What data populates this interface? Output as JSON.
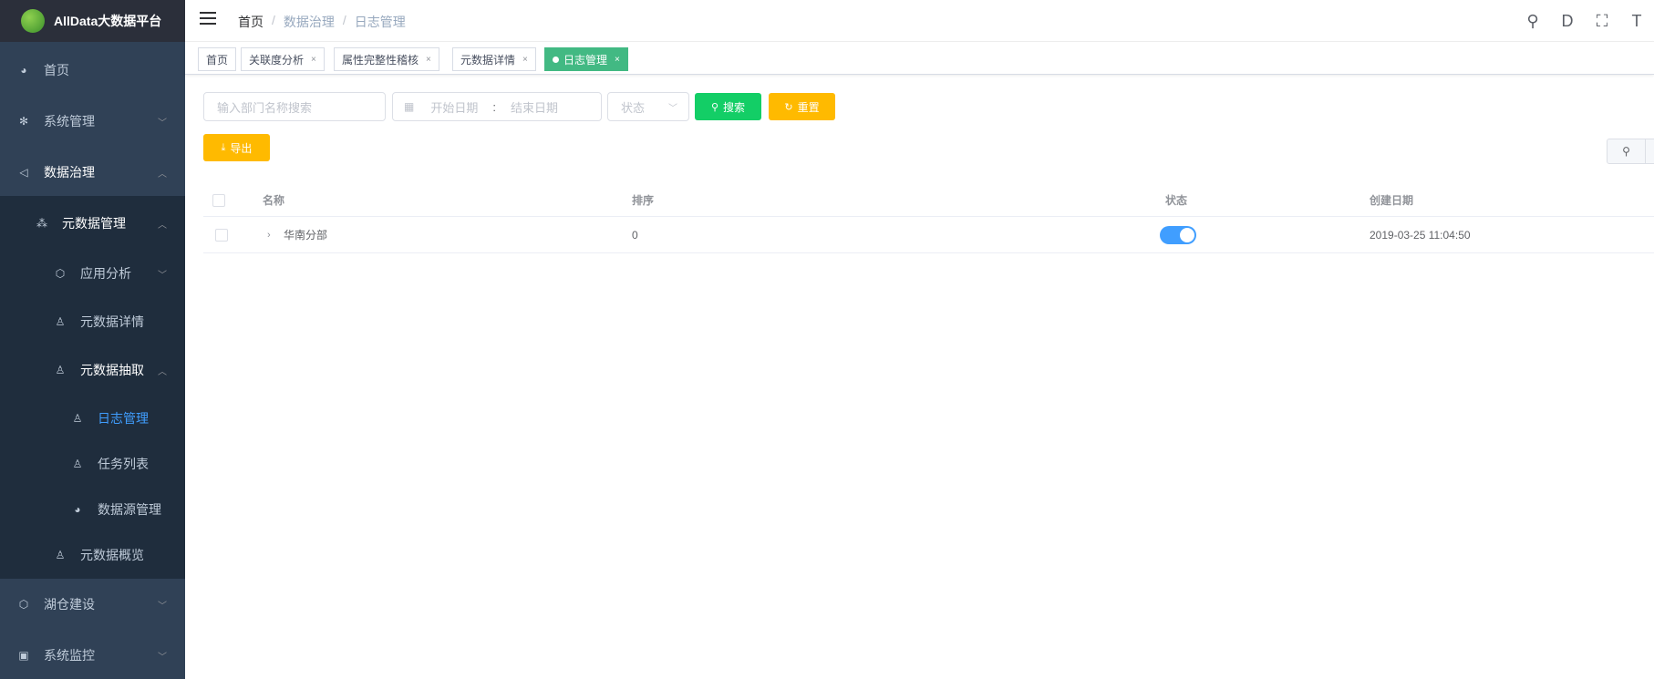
{
  "app": {
    "title": "AllData大数据平台"
  },
  "sidebar": {
    "items": [
      {
        "label": "首页",
        "icon": "dashboard-icon"
      },
      {
        "label": "系统管理",
        "icon": "gear-icon"
      },
      {
        "label": "数据治理",
        "icon": "send-icon"
      },
      {
        "label": "元数据管理",
        "icon": "tree-icon"
      },
      {
        "label": "应用分析",
        "icon": "cube-icon"
      },
      {
        "label": "元数据详情",
        "icon": "user-icon"
      },
      {
        "label": "元数据抽取",
        "icon": "user-icon"
      },
      {
        "label": "日志管理",
        "icon": "user-icon"
      },
      {
        "label": "任务列表",
        "icon": "user-icon"
      },
      {
        "label": "数据源管理",
        "icon": "dashboard-icon"
      },
      {
        "label": "元数据概览",
        "icon": "user-icon"
      },
      {
        "label": "湖仓建设",
        "icon": "cube-icon"
      },
      {
        "label": "系统监控",
        "icon": "monitor-icon"
      }
    ]
  },
  "header": {
    "breadcrumb": [
      "首页",
      "数据治理",
      "日志管理"
    ],
    "icons": [
      "search-icon",
      "document-icon",
      "fullscreen-icon",
      "font-size-icon"
    ]
  },
  "tags": [
    {
      "label": "首页"
    },
    {
      "label": "关联度分析"
    },
    {
      "label": "属性完整性稽核"
    },
    {
      "label": "元数据详情"
    },
    {
      "label": "日志管理"
    }
  ],
  "filters": {
    "name_placeholder": "输入部门名称搜索",
    "start_placeholder": "开始日期",
    "range_sep": ":",
    "end_placeholder": "结束日期",
    "status_placeholder": "状态",
    "search_label": "搜索",
    "reset_label": "重置",
    "export_label": "导出"
  },
  "table": {
    "columns": [
      "名称",
      "排序",
      "状态",
      "创建日期"
    ],
    "rows": [
      {
        "name": "华南分部",
        "sort": "0",
        "status_on": true,
        "created": "2019-03-25 11:04:50"
      }
    ]
  },
  "colors": {
    "sidebar_bg": "#304156",
    "active_tag": "#42b983",
    "primary": "#409eff",
    "search_btn": "#13ce66",
    "reset_btn": "#ffba00"
  }
}
